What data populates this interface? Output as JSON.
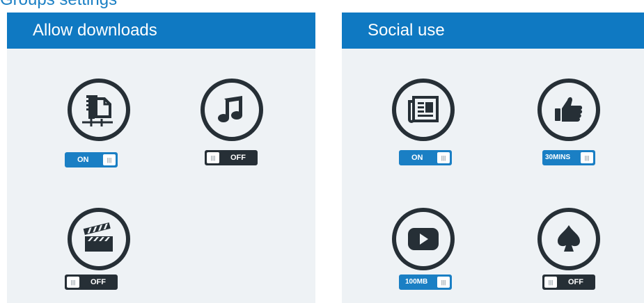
{
  "top_text": "Groups settings",
  "panels": {
    "left": {
      "title": "Allow downloads",
      "tiles": [
        {
          "icon": "file-zip-icon",
          "toggle": {
            "state": "on",
            "label": "ON"
          }
        },
        {
          "icon": "music-note-icon",
          "toggle": {
            "state": "off",
            "label": "OFF"
          }
        },
        {
          "icon": "clapperboard-icon",
          "toggle": {
            "state": "off",
            "label": "OFF"
          }
        }
      ]
    },
    "right": {
      "title": "Social use",
      "tiles": [
        {
          "icon": "newspaper-icon",
          "toggle": {
            "state": "on",
            "label": "ON"
          }
        },
        {
          "icon": "thumbs-up-icon",
          "toggle": {
            "state": "on",
            "label": "30MINS"
          }
        },
        {
          "icon": "play-button-icon",
          "toggle": {
            "state": "on",
            "label": "100MB"
          }
        },
        {
          "icon": "spade-icon",
          "toggle": {
            "state": "off",
            "label": "OFF"
          }
        }
      ]
    }
  },
  "knob_glyph": "|||",
  "colors": {
    "accent": "#0f79c2",
    "toggle_on": "#1a7fc4",
    "toggle_off": "#262f36",
    "icon": "#262f36",
    "panel_bg": "#eef2f5"
  }
}
